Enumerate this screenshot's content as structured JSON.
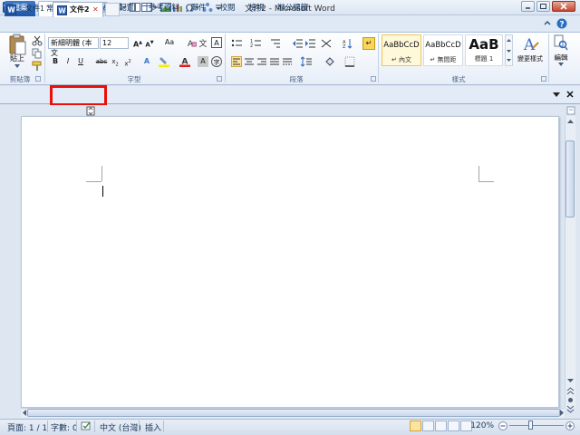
{
  "window": {
    "title": "文件2 - Microsoft Word"
  },
  "ribbon_tabs": [
    "檔案",
    "常用",
    "插入",
    "版面配置",
    "參考資料",
    "郵件",
    "校閱",
    "檢視",
    "辦公標籤"
  ],
  "ribbon": {
    "clipboard": {
      "paste_label": "貼上",
      "group_label": "剪貼簿"
    },
    "font": {
      "font_name": "新細明體 (本文",
      "font_size": "12",
      "group_label": "字型",
      "aa_label": "Aa"
    },
    "paragraph": {
      "group_label": "段落"
    },
    "styles": {
      "items": [
        {
          "preview": "AaBbCcD",
          "name": "↵ 內文"
        },
        {
          "preview": "AaBbCcD",
          "name": "↵ 無間距"
        },
        {
          "preview": "AaB",
          "name": "標題 1"
        }
      ],
      "group_label": "樣式",
      "change_styles_label": "變更樣式"
    },
    "editing": {
      "label": "編輯"
    }
  },
  "doc_tabs": [
    {
      "label": "文件1"
    },
    {
      "label": "文件2",
      "close": "✕"
    }
  ],
  "status": {
    "page": "頁面: 1 / 1",
    "words": "字數: 0",
    "language": "中文 (台灣)",
    "mode": "插入",
    "zoom": "120%"
  },
  "colors": {
    "file_tab": "#2a63b3",
    "highlight": "#e8100b",
    "text_highlight": "#f5f000",
    "font_color": "#e21c1c"
  }
}
